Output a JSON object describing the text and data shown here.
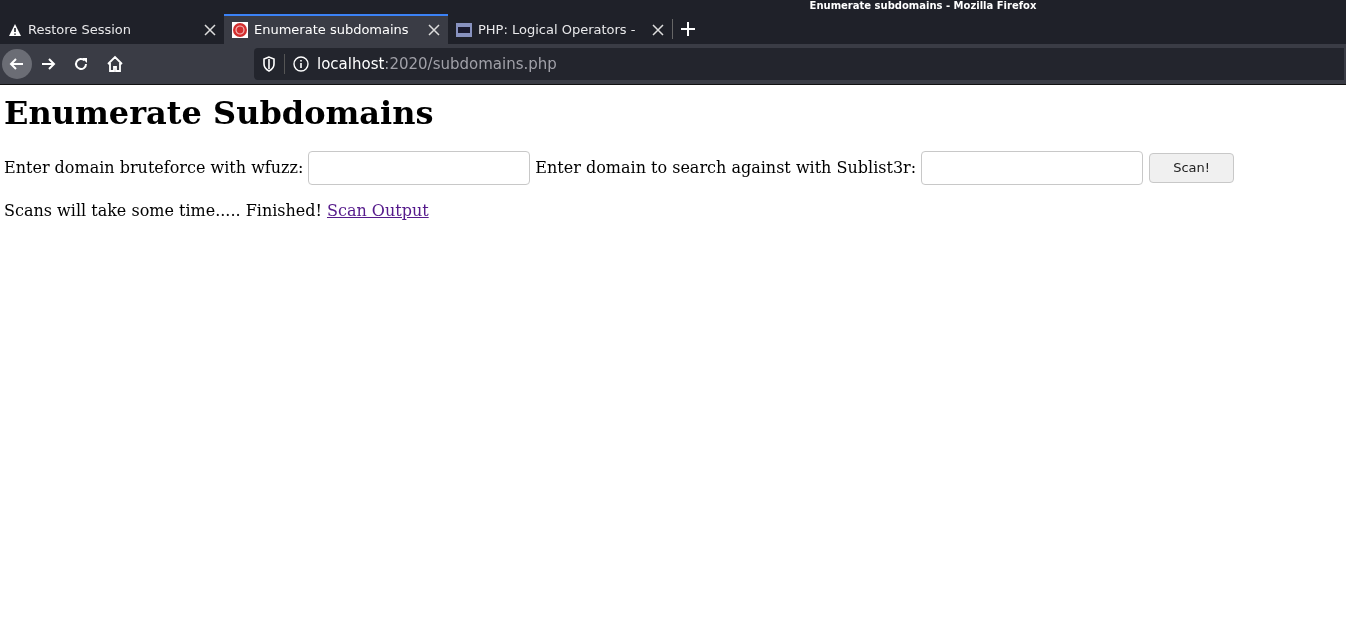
{
  "window": {
    "title": "Enumerate subdomains - Mozilla Firefox"
  },
  "tabs": [
    {
      "label": "Restore Session",
      "kind": "warning",
      "selected": false
    },
    {
      "label": "Enumerate subdomains",
      "kind": "favicon",
      "selected": true
    },
    {
      "label": "PHP: Logical Operators -",
      "kind": "php",
      "selected": false
    }
  ],
  "address_bar": {
    "host": "localhost",
    "rest": ":2020/subdomains.php"
  },
  "page": {
    "heading": "Enumerate Subdomains",
    "fields": [
      {
        "label": "Enter domain bruteforce with wfuzz:"
      },
      {
        "label": "Enter domain to search against with Sublist3r:"
      }
    ],
    "button": "Scan!",
    "status": "Scans will take some time..... Finished!",
    "link": "Scan Output"
  }
}
